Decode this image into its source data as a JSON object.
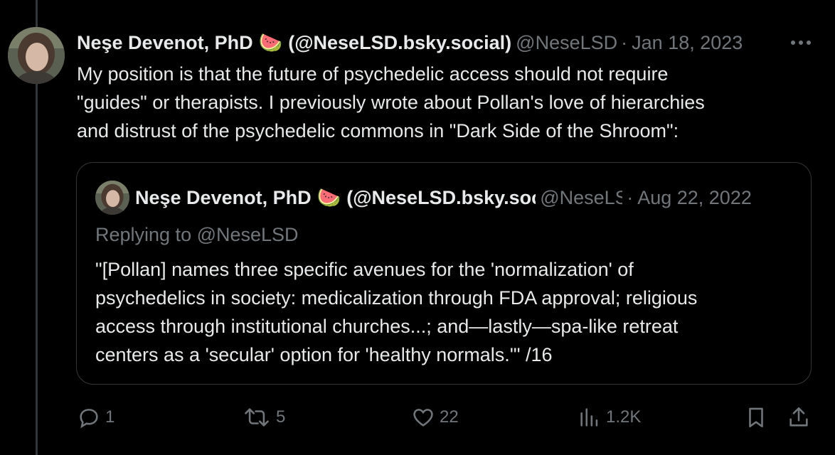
{
  "tweet": {
    "author_name": "Neşe Devenot, PhD",
    "author_emoji": "🍉",
    "author_extra": "(@NeseLSD.bsky.social)",
    "handle": "@NeseLSD",
    "separator": "·",
    "date": "Jan 18, 2023",
    "text_lines": [
      "My position is that the future of psychedelic access should not require",
      "\"guides\" or therapists. I previously wrote about Pollan's love of hierarchies",
      "and distrust of the psychedelic commons in \"Dark Side of the Shroom\":"
    ]
  },
  "quote": {
    "author_name": "Neşe Devenot, PhD",
    "author_emoji": "🍉",
    "author_extra": "(@NeseLSD.bsky.social)",
    "handle": "@NeseLSD",
    "separator": "·",
    "date": "Aug 22, 2022",
    "replying_to": "Replying to @NeseLSD",
    "text_lines": [
      "\"[Pollan] names three specific avenues for the 'normalization' of",
      "psychedelics in society: medicalization through FDA approval; religious",
      "access through institutional churches...; and—lastly—spa-like retreat",
      "centers as a 'secular' option for 'healthy normals.'\"  /16"
    ]
  },
  "actions": {
    "replies": "1",
    "reposts": "5",
    "likes": "22",
    "views": "1.2K"
  },
  "icons": [
    "reply-icon",
    "repost-icon",
    "like-icon",
    "views-icon",
    "bookmark-icon",
    "share-icon",
    "more-icon"
  ],
  "colors": {
    "background": "#000000",
    "text": "#e7e9ea",
    "muted": "#71767b",
    "border": "#333639"
  }
}
